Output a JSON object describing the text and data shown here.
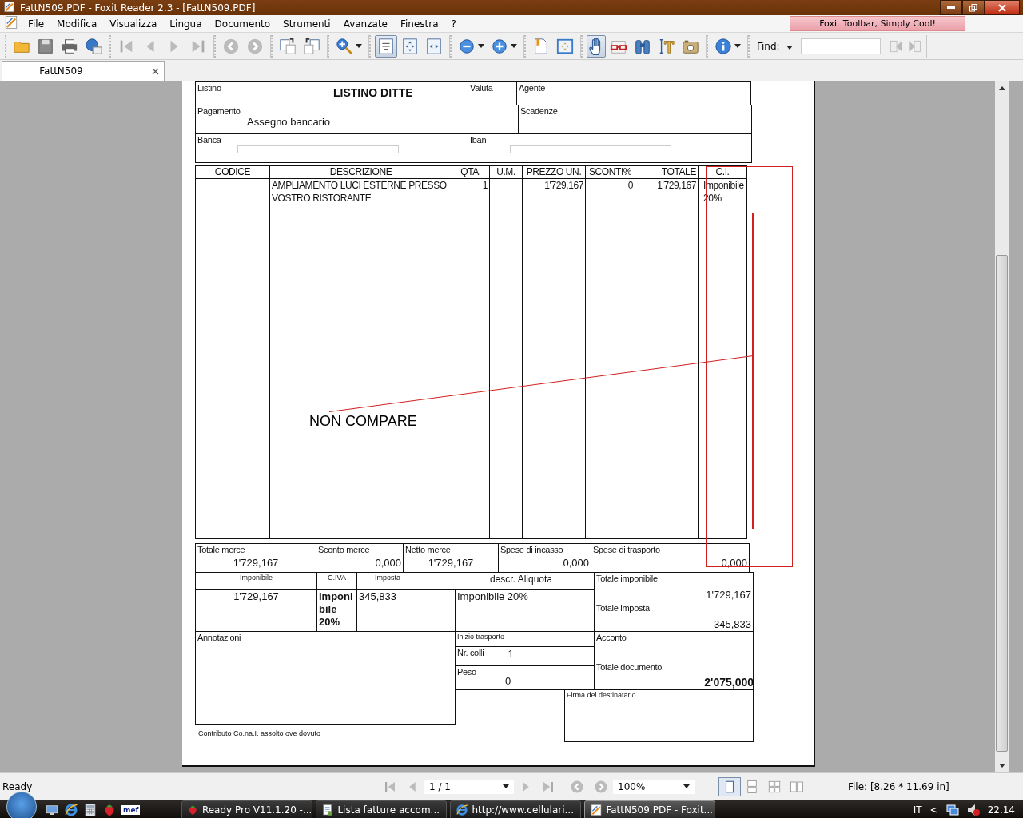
{
  "window": {
    "title": "FattN509.PDF - Foxit Reader 2.3 - [FattN509.PDF]"
  },
  "menu": [
    {
      "label": "File"
    },
    {
      "label": "Modifica"
    },
    {
      "label": "Visualizza"
    },
    {
      "label": "Lingua"
    },
    {
      "label": "Documento"
    },
    {
      "label": "Strumenti"
    },
    {
      "label": "Avanzate"
    },
    {
      "label": "Finestra"
    },
    {
      "label": "?"
    }
  ],
  "banner": "Foxit Toolbar, Simply Cool!",
  "toolbar": {
    "groups": [
      [
        {
          "kind": "folder",
          "selected": false,
          "menu": false
        },
        {
          "kind": "disk",
          "selected": false,
          "menu": false
        },
        {
          "kind": "printer",
          "selected": false,
          "menu": false
        },
        {
          "kind": "globe-mail",
          "selected": false,
          "menu": false
        }
      ],
      [
        {
          "kind": "first",
          "selected": false,
          "menu": false
        },
        {
          "kind": "prev",
          "selected": false,
          "menu": false
        },
        {
          "kind": "next",
          "selected": false,
          "menu": false
        },
        {
          "kind": "last",
          "selected": false,
          "menu": false
        }
      ],
      [
        {
          "kind": "back",
          "selected": false,
          "menu": false
        },
        {
          "kind": "forward",
          "selected": false,
          "menu": false
        }
      ],
      [
        {
          "kind": "rotate-right",
          "selected": false,
          "menu": false
        },
        {
          "kind": "rotate-left",
          "selected": false,
          "menu": false
        }
      ],
      [
        {
          "kind": "zoom-in",
          "selected": false,
          "menu": true
        }
      ],
      [
        {
          "kind": "actual-size",
          "selected": true,
          "menu": false
        },
        {
          "kind": "fit-page",
          "selected": false,
          "menu": false
        },
        {
          "kind": "fit-width",
          "selected": false,
          "menu": false
        }
      ],
      [
        {
          "kind": "minus",
          "selected": false,
          "menu": true
        },
        {
          "kind": "plus",
          "selected": false,
          "menu": true
        }
      ],
      [
        {
          "kind": "bookmark",
          "selected": false,
          "menu": false
        },
        {
          "kind": "fullscreen",
          "selected": false,
          "menu": false
        }
      ],
      [
        {
          "kind": "hand",
          "selected": true,
          "menu": false
        },
        {
          "kind": "glasses",
          "selected": false,
          "menu": false
        },
        {
          "kind": "binoculars",
          "selected": false,
          "menu": false
        },
        {
          "kind": "text-select",
          "selected": false,
          "menu": false
        },
        {
          "kind": "camera",
          "selected": false,
          "menu": false
        }
      ],
      [
        {
          "kind": "info",
          "selected": false,
          "menu": true
        }
      ]
    ],
    "find_label": "Find:"
  },
  "tabs": [
    {
      "label": "FattN509",
      "selected": true
    }
  ],
  "document": {
    "header_rows": [
      [
        {
          "label": "Listino",
          "value": "LISTINO DITTE"
        },
        {
          "label": "Valuta"
        },
        {
          "label": "Agente"
        }
      ],
      [
        {
          "label": "Pagamento",
          "value": "Assegno bancario"
        },
        {
          "label": "Scadenze"
        }
      ],
      [
        {
          "label": "Banca",
          "kind": "redacted"
        },
        {
          "label": "Iban",
          "kind": "redacted"
        }
      ]
    ],
    "items_table": {
      "columns": [
        {
          "label": "CODICE"
        },
        {
          "label": "DESCRIZIONE"
        },
        {
          "label": "QTA."
        },
        {
          "label": "U.M."
        },
        {
          "label": "PREZZO UN."
        },
        {
          "label": "SCONTI%"
        },
        {
          "label": "TOTALE"
        },
        {
          "label": "C.I."
        }
      ],
      "rows": [
        {
          "cells": [
            null,
            "AMPLIAMENTO LUCI ESTERNE PRESSO VOSTRO RISTORANTE",
            "1",
            null,
            "1'729,167",
            "0",
            "1'729,167",
            "Imponibile 20%"
          ]
        }
      ]
    },
    "totals": [
      {
        "label": "Totale merce",
        "value": "1'729,167"
      },
      {
        "label": "Sconto merce",
        "value": "0,000"
      },
      {
        "label": "Netto merce",
        "value": "1'729,167"
      },
      {
        "label": "Spese di incasso",
        "value": "0,000"
      },
      {
        "label": "Spese di trasporto",
        "value": "0,000"
      }
    ],
    "tax": {
      "imponibile_label": "Imponibile",
      "civa_label": "C.IVA",
      "imposta_label": "Imposta",
      "descr_label": "descr. Aliquota",
      "imponibile": "1'729,167",
      "civa": "Imponibile 20%",
      "imposta": "345,833",
      "descr": "Imponibile 20%"
    },
    "summary": [
      {
        "label": "Totale imponibile",
        "value": "1'729,167"
      },
      {
        "label": "Totale imposta",
        "value": "345,833"
      },
      {
        "label": "Acconto"
      },
      {
        "label": "Totale documento",
        "value": "2'075,000"
      }
    ],
    "annotazioni": "Annotazioni",
    "transport": [
      {
        "label": "Inizio trasporto"
      },
      {
        "label": "Nr. colli",
        "value": "1"
      },
      {
        "label": "Peso",
        "value": "0"
      }
    ],
    "firma": "Firma del destinatario",
    "footnote": "Contributo Co.na.I. assolto ove dovuto"
  },
  "annotation": {
    "text": "NON COMPARE"
  },
  "status_bar": {
    "text": "Ready",
    "page": "1 / 1",
    "zoom": "100%",
    "file_info": "File: [8.26 * 11.69 in]",
    "view_modes": [
      {
        "kind": "single",
        "selected": true
      },
      {
        "kind": "continuous",
        "selected": false
      },
      {
        "kind": "facing",
        "selected": false
      },
      {
        "kind": "facing-continuous",
        "selected": false
      }
    ]
  },
  "taskbar": {
    "quick_launch": [
      {
        "kind": "desktop"
      },
      {
        "kind": "ie"
      },
      {
        "kind": "calculator"
      },
      {
        "kind": "strawberry"
      }
    ],
    "mef": "mef",
    "tasks": [
      {
        "label": "Ready Pro V11.1.20 -...",
        "kind": "strawberry",
        "selected": false
      },
      {
        "label": "Lista fatture accom...",
        "kind": "list",
        "selected": false
      },
      {
        "label": "http://www.cellulari...",
        "kind": "ie",
        "selected": false
      },
      {
        "label": "FattN509.PDF - Foxit...",
        "kind": "foxit",
        "selected": true
      }
    ],
    "language": "IT",
    "tray_arrow": "<",
    "clock": "22.14"
  }
}
